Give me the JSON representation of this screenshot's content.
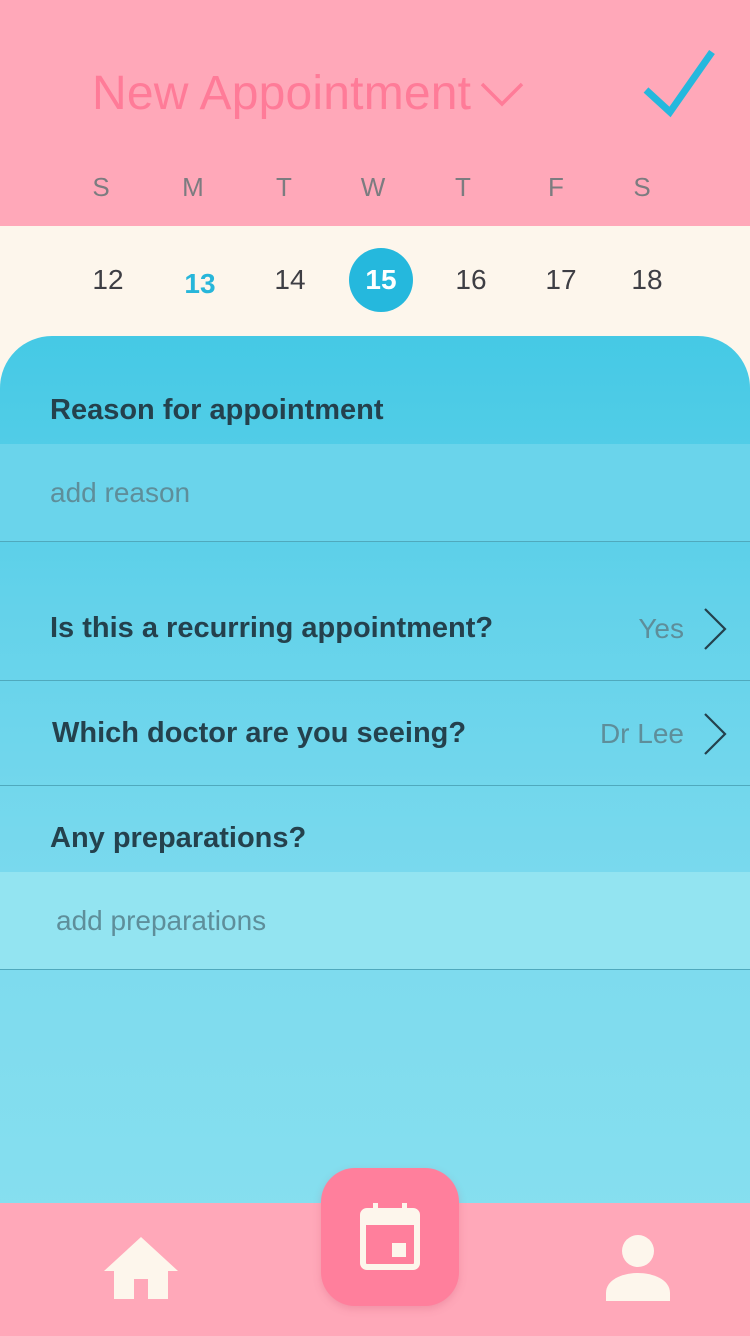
{
  "header": {
    "title": "New Appointment",
    "weekdays": [
      "S",
      "M",
      "T",
      "W",
      "T",
      "F",
      "S"
    ]
  },
  "calendar": {
    "days": [
      "12",
      "13",
      "14",
      "15",
      "16",
      "17",
      "18"
    ],
    "today": "13",
    "selected": "15"
  },
  "form": {
    "reason_label": "Reason for appointment",
    "reason_placeholder": "add reason",
    "reason_value": "",
    "recurring_question": "Is this a recurring appointment?",
    "recurring_value": "Yes",
    "doctor_question": "Which doctor are you seeing?",
    "doctor_value": "Dr Lee",
    "preparations_label": "Any preparations?",
    "preparations_placeholder": "add preparations",
    "preparations_value": ""
  },
  "nav": {
    "items": [
      {
        "icon": "home-icon"
      },
      {
        "icon": "calendar-icon"
      },
      {
        "icon": "person-icon"
      }
    ]
  },
  "colors": {
    "header_bg": "#ffa8b9",
    "title": "#ff7b98",
    "accent_blue": "#25b8dd",
    "date_strip_bg": "#fdf6ec",
    "panel_top": "#45c9e5",
    "panel_bottom": "#86dfef",
    "fab": "#ff7f9c",
    "icon_light": "#fdf6ec",
    "label_text": "#24414d"
  }
}
